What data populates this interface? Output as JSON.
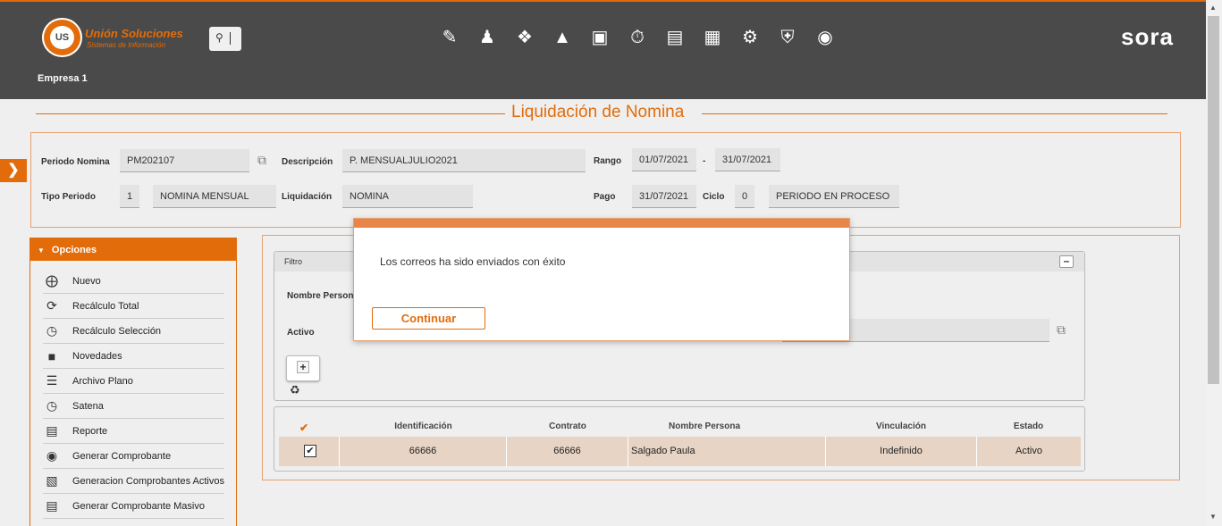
{
  "header": {
    "logo_initials": "US",
    "company_name": "Unión Soluciones",
    "company_tagline": "Sistemas de Información",
    "empresa": "Empresa 1",
    "brand": "sora",
    "nav_icons": [
      "edit-doc-icon",
      "user-icon",
      "gift-icon",
      "org-chart-icon",
      "person-card-icon",
      "stopwatch-icon",
      "document-icon",
      "presentation-icon",
      "gears-icon",
      "shield-check-icon",
      "search-person-icon"
    ]
  },
  "page": {
    "title": "Liquidación de Nomina"
  },
  "form": {
    "periodo_label": "Periodo Nomina",
    "periodo_value": "PM202107",
    "descripcion_label": "Descripción",
    "descripcion_value": "P. MENSUALJULIO2021",
    "rango_label": "Rango",
    "rango_from": "01/07/2021",
    "rango_sep": "-",
    "rango_to": "31/07/2021",
    "tipo_label": "Tipo Periodo",
    "tipo_code": "1",
    "tipo_value": "NOMINA MENSUAL",
    "liquidacion_label": "Liquidación",
    "liquidacion_value": "NOMINA",
    "pago_label": "Pago",
    "pago_value": "31/07/2021",
    "ciclo_label": "Ciclo",
    "ciclo_value": "0",
    "estado_value": "PERIODO EN PROCESO"
  },
  "opciones": {
    "title": "Opciones",
    "items": [
      {
        "label": "Nuevo",
        "icon": "plus-circle-icon"
      },
      {
        "label": "Recálculo Total",
        "icon": "refresh-icon"
      },
      {
        "label": "Recálculo Selección",
        "icon": "clock-icon"
      },
      {
        "label": "Novedades",
        "icon": "comment-icon"
      },
      {
        "label": "Archivo Plano",
        "icon": "lines-icon"
      },
      {
        "label": "Satena",
        "icon": "clock-icon"
      },
      {
        "label": "Reporte",
        "icon": "report-icon"
      },
      {
        "label": "Generar Comprobante",
        "icon": "eye-icon"
      },
      {
        "label": "Generacion Comprobantes Activos",
        "icon": "doc-gear-icon"
      },
      {
        "label": "Generar Comprobante Masivo",
        "icon": "report-icon"
      }
    ]
  },
  "filtro": {
    "title": "Filtro",
    "nombre_label": "Nombre Person",
    "activo_label": "Activo"
  },
  "grid": {
    "columns": [
      "Identificación",
      "Contrato",
      "Nombre Persona",
      "Vinculación",
      "Estado"
    ],
    "rows": [
      {
        "identificacion": "66666",
        "contrato": "66666",
        "nombre": "Salgado Paula",
        "vinculacion": "Indefinido",
        "estado": "Activo"
      }
    ]
  },
  "modal": {
    "message": "Los correos ha sido enviados con éxito",
    "button": "Continuar"
  },
  "colors": {
    "accent": "#e36c0a",
    "topbar": "#4a4a4a"
  }
}
